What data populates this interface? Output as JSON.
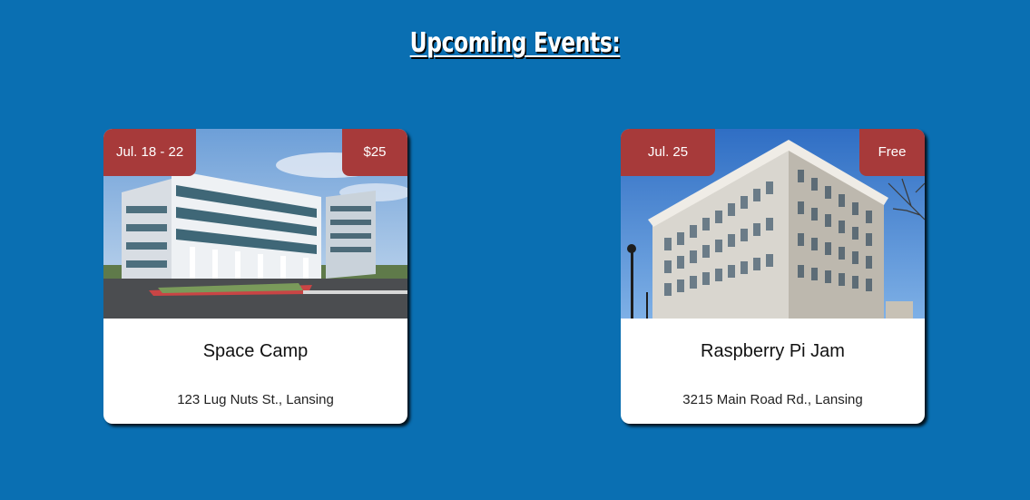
{
  "page": {
    "heading": "Upcoming Events:"
  },
  "events": [
    {
      "date": "Jul. 18 - 22",
      "price": "$25",
      "title": "Space Camp",
      "address": "123 Lug Nuts St., Lansing"
    },
    {
      "date": "Jul. 25",
      "price": "Free",
      "title": "Raspberry Pi Jam",
      "address": "3215 Main Road Rd., Lansing"
    }
  ],
  "colors": {
    "background": "#0a6fb2",
    "badge": "#a73a3a",
    "card": "#ffffff"
  }
}
